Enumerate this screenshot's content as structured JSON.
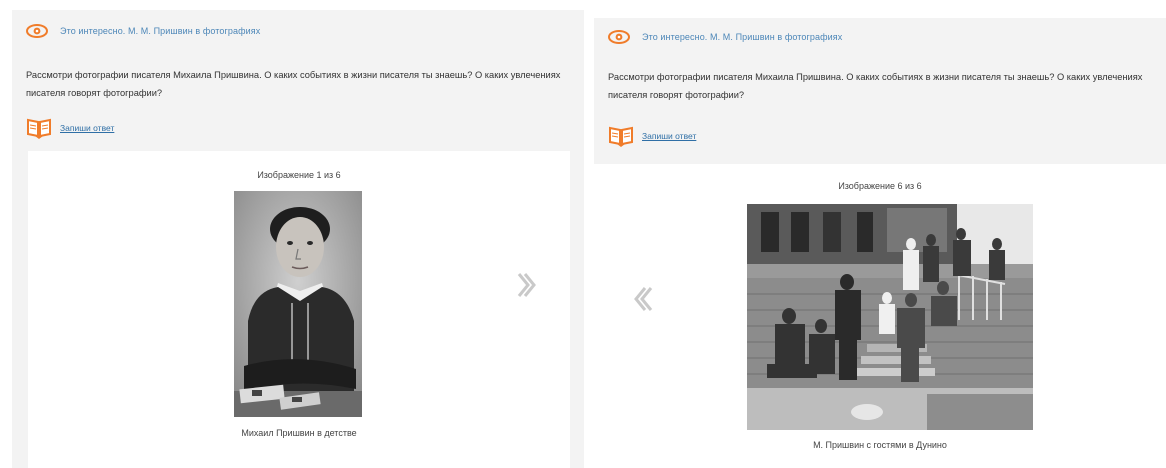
{
  "panels": [
    {
      "title": "Это интересно. М. М. Пришвин в фотографиях",
      "description": "Рассмотри фотографии писателя Михаила Пришвина. О каких событиях в жизни писателя ты знаешь? О каких увлечениях писателя говорят фотографии?",
      "answer_link": "Запиши ответ",
      "slide_counter": "Изображение 1 из 6",
      "caption": "Михаил Пришвин в детстве",
      "photo_description": "portrait of a boy",
      "nav": "next"
    },
    {
      "title": "Это интересно. М. М. Пришвин в фотографиях",
      "description": "Рассмотри фотографии писателя Михаила Пришвина. О каких событиях в жизни писателя ты знаешь? О каких увлечениях писателя говорят фотографии?",
      "answer_link": "Запиши ответ",
      "slide_counter": "Изображение 6 из 6",
      "caption": "М. Пришвин с гостями в Дунино",
      "photo_description": "group of people on porch of a wooden house",
      "nav": "prev"
    }
  ],
  "colors": {
    "accent": "#f07c2a",
    "link": "#2f6fa6",
    "title": "#4d87b8",
    "panel_bg": "#f3f3f3",
    "arrow": "#c9c9c9"
  },
  "icons": {
    "header": "eye-icon",
    "answer": "book-icon",
    "next": "chevron-right-double-icon",
    "prev": "chevron-left-double-icon"
  }
}
